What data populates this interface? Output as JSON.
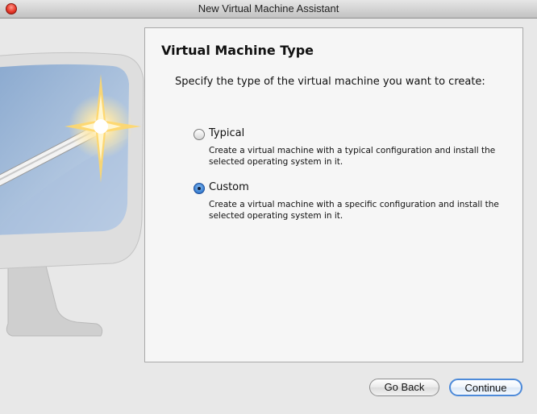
{
  "window": {
    "title": "New Virtual Machine Assistant"
  },
  "panel": {
    "title": "Virtual Machine Type",
    "instruction": "Specify the type of the virtual machine you want to create:",
    "options": [
      {
        "label": "Typical",
        "description": "Create a virtual machine with a typical configuration and install the selected operating system in it.",
        "selected": false
      },
      {
        "label": "Custom",
        "description": "Create a virtual machine with a specific configuration and install the selected operating system in it.",
        "selected": true
      }
    ]
  },
  "buttons": {
    "go_back": "Go Back",
    "continue": "Continue"
  },
  "icons": {
    "close": "close-icon",
    "illustration": "monitor-magic-wand-illustration"
  },
  "colors": {
    "accent": "#3f85d6",
    "close_button": "#e8382a"
  }
}
